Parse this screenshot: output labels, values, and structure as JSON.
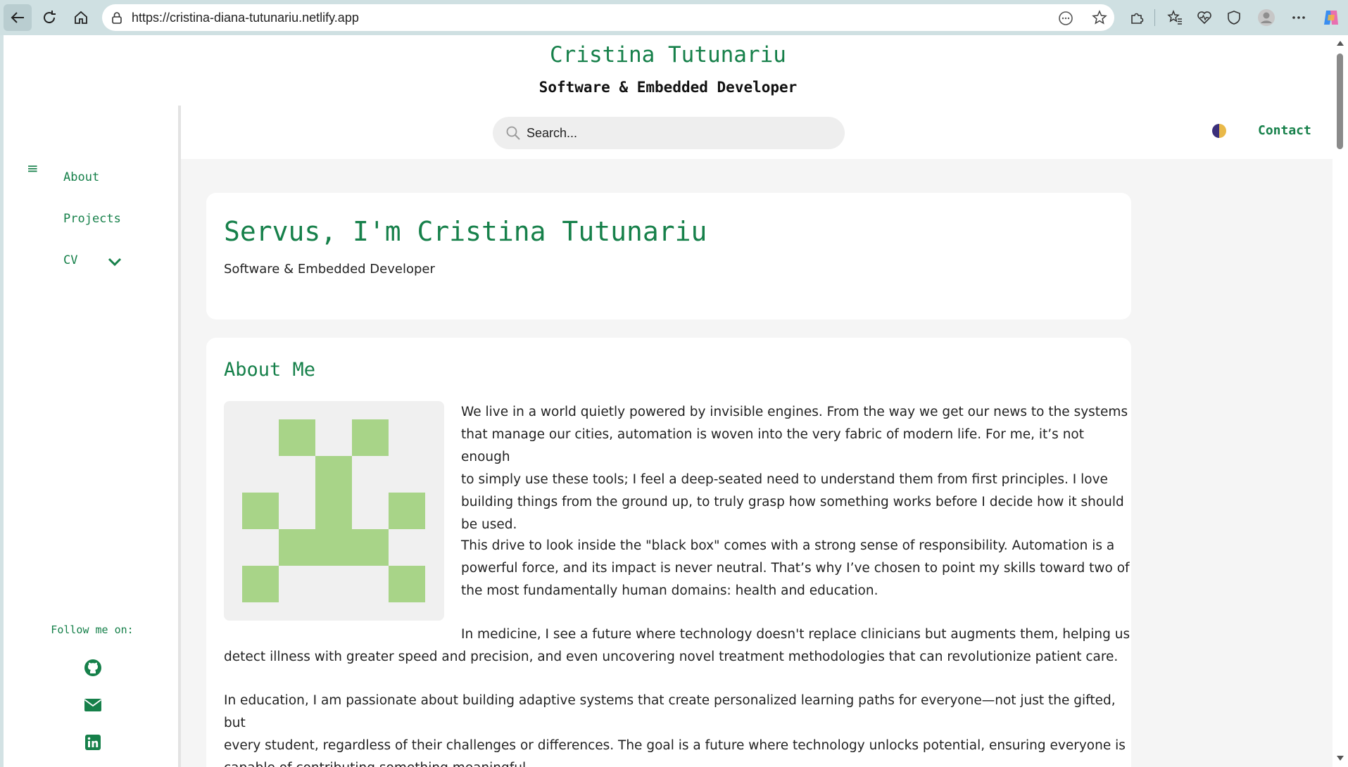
{
  "browser": {
    "url": "https://cristina-diana-tutunariu.netlify.app",
    "icons": [
      "back-icon",
      "reload-icon",
      "home-icon",
      "lock-icon",
      "reader-icon",
      "favorite-star-icon",
      "extensions-icon",
      "favorites-icon",
      "health-icon",
      "shield-icon",
      "profile-icon",
      "more-icon",
      "copilot-icon"
    ]
  },
  "header": {
    "title": "Cristina Tutunariu",
    "subtitle": "Software & Embedded Developer"
  },
  "sidebar": {
    "menu_icon": "≡",
    "items": [
      {
        "label": "About"
      },
      {
        "label": "Projects"
      },
      {
        "label": "CV"
      }
    ],
    "follow_label": "Follow me on:",
    "socials": [
      "github-icon",
      "email-icon",
      "linkedin-icon"
    ]
  },
  "topbar": {
    "search_placeholder": "Search...",
    "contact_label": "Contact"
  },
  "hero": {
    "title": "Servus, I'm Cristina Tutunariu",
    "subtitle": "Software & Embedded Developer"
  },
  "about": {
    "title": "About Me",
    "p1_lines": [
      "We live in a world quietly powered by invisible engines. From the way we get our news to the systems",
      "that manage our cities, automation is woven into the very fabric of modern life. For me, it’s not enough",
      "to simply use these tools; I feel a deep-seated need to understand them from first principles. I love",
      "building things from the ground up, to truly grasp how something works before I decide how it should",
      "be used."
    ],
    "p2_lines": [
      "This drive to look inside the \"black box\" comes with a strong sense of responsibility. Automation is a",
      "powerful force, and its impact is never neutral. That’s why I’ve chosen to point my skills toward two of",
      "the most fundamentally human domains: health and education."
    ],
    "p3_lines": [
      "In medicine, I see a future where technology doesn't replace clinicians but augments them, helping us",
      "detect illness with greater speed and precision, and even uncovering novel treatment methodologies that can revolutionize patient care."
    ],
    "p4_lines": [
      "In education, I am passionate about building adaptive systems that create personalized learning paths for everyone—not just the gifted, but",
      "every student, regardless of their challenges or differences. The goal is a future where technology unlocks potential, ensuring everyone is",
      "capable of contributing something meaningful."
    ]
  },
  "colors": {
    "accent": "#16804a",
    "avatar_pixel": "#a8d488",
    "page_bg": "#f5f5f5"
  }
}
